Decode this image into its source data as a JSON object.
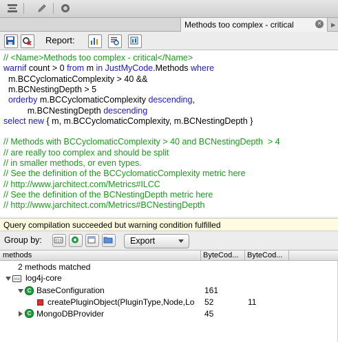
{
  "tab": {
    "title": "Methods too complex - critical",
    "close_glyph": "×",
    "forward_glyph": "▸"
  },
  "toolbar": {
    "icons": [
      "hierarchy-icon",
      "pencil-icon",
      "zoom-icon"
    ]
  },
  "report": {
    "label": "Report:",
    "icons": [
      "save-icon",
      "settings-icon",
      "report-chart-icon",
      "report-list-icon",
      "report-html-icon"
    ]
  },
  "query": {
    "lines": [
      [
        {
          "s": "c",
          "t": "// <Name>Methods too complex - critical</Name>"
        }
      ],
      [
        {
          "s": "k",
          "t": "warnif "
        },
        {
          "s": "t",
          "t": "count > 0 "
        },
        {
          "s": "k",
          "t": "from "
        },
        {
          "s": "t",
          "t": "m "
        },
        {
          "s": "k",
          "t": "in JustMyCode"
        },
        {
          "s": "t",
          "t": ".Methods "
        },
        {
          "s": "k",
          "t": "where"
        }
      ],
      [
        {
          "s": "t",
          "t": "  m.BCCyclomaticComplexity > 40 &&"
        }
      ],
      [
        {
          "s": "t",
          "t": "  m.BCNestingDepth > 5"
        }
      ],
      [
        {
          "s": "k",
          "t": "  orderby "
        },
        {
          "s": "t",
          "t": "m.BCCyclomaticComplexity "
        },
        {
          "s": "k",
          "t": "descending"
        },
        {
          "s": "t",
          "t": ","
        }
      ],
      [
        {
          "s": "t",
          "t": "          m.BCNestingDepth "
        },
        {
          "s": "k",
          "t": "descending"
        }
      ],
      [
        {
          "s": "k",
          "t": "select new "
        },
        {
          "s": "t",
          "t": "{ m, m.BCCyclomaticComplexity, m.BCNestingDepth }"
        }
      ],
      [
        {
          "s": "t",
          "t": ""
        }
      ],
      [
        {
          "s": "c",
          "t": "// Methods with BCCyclomaticComplexity > 40 and BCNestingDepth  > 4"
        }
      ],
      [
        {
          "s": "c",
          "t": "// are really too complex and should be split"
        }
      ],
      [
        {
          "s": "c",
          "t": "// in smaller methods, or even types."
        }
      ],
      [
        {
          "s": "c",
          "t": "// See the definition of the BCCyclomaticComplexity metric here"
        }
      ],
      [
        {
          "s": "c",
          "t": "// http://www.jarchitect.com/Metrics#ILCC"
        }
      ],
      [
        {
          "s": "c",
          "t": "// See the definition of the BCNestingDepth metric here"
        }
      ],
      [
        {
          "s": "c",
          "t": "// http://www.jarchitect.com/Metrics#BCNestingDepth"
        }
      ]
    ]
  },
  "status": {
    "text": "Query compilation succeeded but warning condition fulfilled"
  },
  "groupby": {
    "label": "Group by:",
    "icons": [
      "group-assembly-icon",
      "group-namespace-icon",
      "group-type-icon",
      "group-folder-icon"
    ],
    "export_label": "Export"
  },
  "results": {
    "columns": [
      "methods",
      "ByteCod...",
      "ByteCod..."
    ],
    "summary": "2 methods matched",
    "rows": [
      {
        "label": "log4j-core",
        "c1": "",
        "c2": "",
        "kind": "assembly"
      },
      {
        "label": "BaseConfiguration",
        "c1": "161",
        "c2": "",
        "kind": "class"
      },
      {
        "label": "createPluginObject(PluginType,Node,Lo",
        "c1": "52",
        "c2": "11",
        "kind": "method"
      },
      {
        "label": "MongoDBProvider",
        "c1": "45",
        "c2": "",
        "kind": "class"
      }
    ]
  },
  "colors": {
    "comment": "#1a9a1a",
    "keyword": "#1c1ad0",
    "status_bg": "#fffbe0",
    "class_icon": "#1a9e3a",
    "method_icon": "#d63030"
  }
}
